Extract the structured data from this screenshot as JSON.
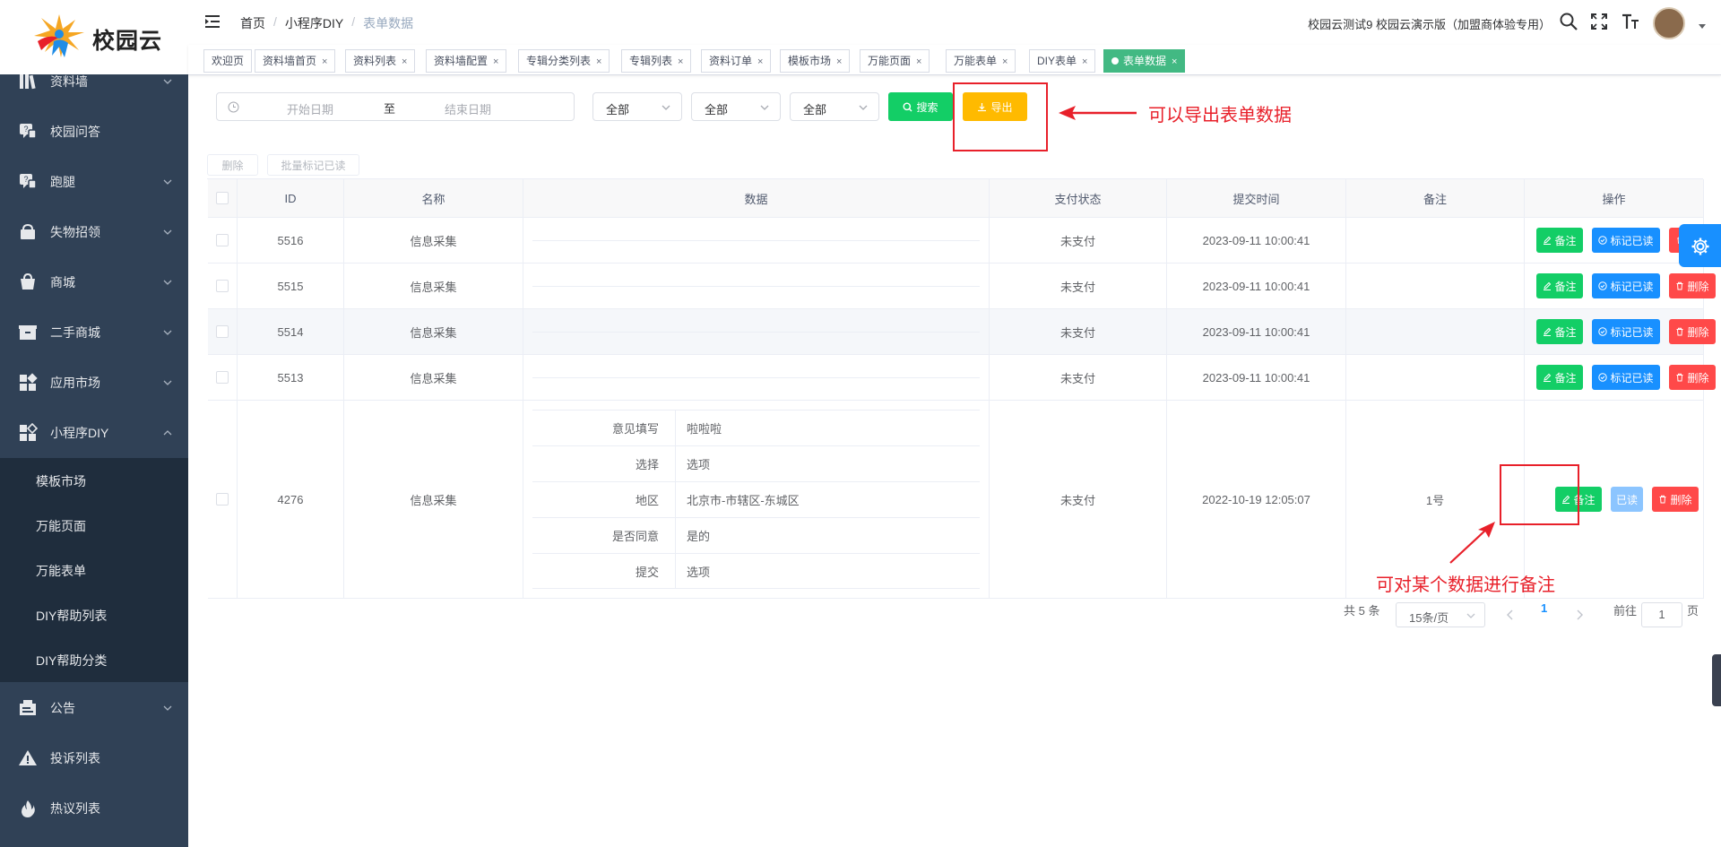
{
  "brand": {
    "name": "校园云"
  },
  "sidebar": {
    "items": [
      {
        "label": "资料墙",
        "icon": "books-icon",
        "has_children": true
      },
      {
        "label": "校园问答",
        "icon": "qa-chat-icon",
        "has_children": false
      },
      {
        "label": "跑腿",
        "icon": "qa-chat-icon",
        "has_children": true
      },
      {
        "label": "失物招领",
        "icon": "gift-bag-icon",
        "has_children": true
      },
      {
        "label": "商城",
        "icon": "shopping-bag-icon",
        "has_children": true
      },
      {
        "label": "二手商城",
        "icon": "box-icon",
        "has_children": true
      },
      {
        "label": "应用市场",
        "icon": "apps-grid-icon",
        "has_children": true
      },
      {
        "label": "小程序DIY",
        "icon": "apps-grid-icon",
        "has_children": true,
        "expanded": true
      },
      {
        "label": "公告",
        "icon": "notice-icon",
        "has_children": true
      },
      {
        "label": "投诉列表",
        "icon": "warning-icon",
        "has_children": false
      },
      {
        "label": "热议列表",
        "icon": "fire-icon",
        "has_children": false
      }
    ],
    "submenu": [
      "模板市场",
      "万能页面",
      "万能表单",
      "DIY帮助列表",
      "DIY帮助分类"
    ]
  },
  "header": {
    "breadcrumb": [
      "首页",
      "小程序DIY",
      "表单数据"
    ],
    "account_text": "校园云测试9 校园云演示版（加盟商体验专用）"
  },
  "tags": [
    {
      "label": "欢迎页",
      "closable": false
    },
    {
      "label": "资料墙首页",
      "closable": true
    },
    {
      "label": "资料列表",
      "closable": true
    },
    {
      "label": "资料墙配置",
      "closable": true
    },
    {
      "label": "专辑分类列表",
      "closable": true
    },
    {
      "label": "专辑列表",
      "closable": true
    },
    {
      "label": "资料订单",
      "closable": true
    },
    {
      "label": "模板市场",
      "closable": true
    },
    {
      "label": "万能页面",
      "closable": true
    },
    {
      "label": "万能表单",
      "closable": true
    },
    {
      "label": "DIY表单",
      "closable": true
    },
    {
      "label": "表单数据",
      "closable": true,
      "active": true
    }
  ],
  "filters": {
    "start_placeholder": "开始日期",
    "range_separator": "至",
    "end_placeholder": "结束日期",
    "selects": [
      "全部",
      "全部",
      "全部"
    ],
    "search_label": "搜索",
    "export_label": "导出"
  },
  "bulk": {
    "delete_label": "删除",
    "mark_read_label": "批量标记已读"
  },
  "annotations": {
    "export_note": "可以导出表单数据",
    "remark_note": "可对某个数据进行备注"
  },
  "table": {
    "columns": [
      "ID",
      "名称",
      "数据",
      "支付状态",
      "提交时间",
      "备注",
      "操作"
    ],
    "rows": [
      {
        "id": "5516",
        "name": "信息采集",
        "pay": "未支付",
        "time": "2023-09-11 10:00:41",
        "remark": ""
      },
      {
        "id": "5515",
        "name": "信息采集",
        "pay": "未支付",
        "time": "2023-09-11 10:00:41",
        "remark": ""
      },
      {
        "id": "5514",
        "name": "信息采集",
        "pay": "未支付",
        "time": "2023-09-11 10:00:41",
        "remark": ""
      },
      {
        "id": "5513",
        "name": "信息采集",
        "pay": "未支付",
        "time": "2023-09-11 10:00:41",
        "remark": ""
      }
    ],
    "expanded_row": {
      "id": "4276",
      "name": "信息采集",
      "pay": "未支付",
      "time": "2022-10-19 12:05:07",
      "remark": "1号",
      "details": [
        {
          "label": "意见填写",
          "value": "啦啦啦"
        },
        {
          "label": "选择",
          "value": "选项"
        },
        {
          "label": "地区",
          "value": "北京市-市辖区-东城区"
        },
        {
          "label": "是否同意",
          "value": "是的"
        },
        {
          "label": "提交",
          "value": "选项"
        }
      ]
    },
    "actions": {
      "remark": "备注",
      "mark_read": "标记已读",
      "read": "已读",
      "delete": "删除"
    }
  },
  "pagination": {
    "total_text": "共 5 条",
    "page_size": "15条/页",
    "current_page": "1",
    "goto_prefix": "前往",
    "goto_value": "1",
    "goto_suffix": "页"
  },
  "colors": {
    "sidebar_bg": "#304156",
    "submenu_bg": "#1f2d3d",
    "active_tag": "#42b983",
    "search": "#13ce66",
    "export": "#ffba00",
    "primary": "#1890ff",
    "danger": "#ff4949",
    "annotation": "#e8202a"
  }
}
